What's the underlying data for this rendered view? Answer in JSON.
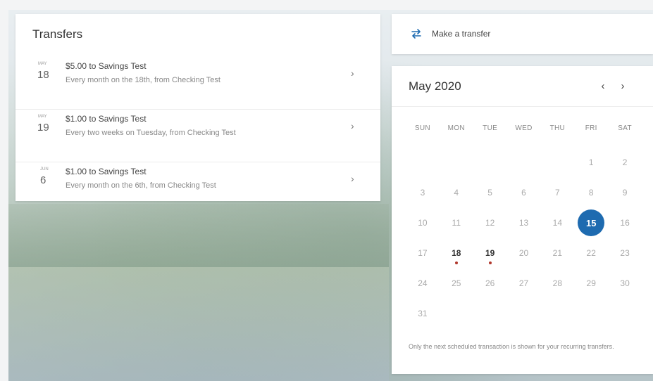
{
  "transfers": {
    "title": "Transfers",
    "items": [
      {
        "month": "MAY",
        "day": "18",
        "title": "$5.00 to Savings Test",
        "subtitle": "Every month on the 18th, from Checking Test"
      },
      {
        "month": "MAY",
        "day": "19",
        "title": "$1.00 to Savings Test",
        "subtitle": "Every two weeks on Tuesday, from Checking Test"
      },
      {
        "month": "JUN",
        "day": "6",
        "title": "$1.00 to Savings Test",
        "subtitle": "Every month on the 6th, from Checking Test"
      }
    ],
    "chevron": "›"
  },
  "make_transfer": {
    "label": "Make a transfer",
    "icon": "swap-arrows-icon",
    "icon_color": "#1e6bb0"
  },
  "calendar": {
    "title": "May 2020",
    "prev": "‹",
    "next": "›",
    "weekdays": [
      "SUN",
      "MON",
      "TUE",
      "WED",
      "THU",
      "FRI",
      "SAT"
    ],
    "first_weekday_index": 5,
    "days_in_month": 31,
    "today": 15,
    "event_days": [
      18,
      19
    ],
    "today_color": "#1e6bb0",
    "event_dot_color": "#b0372c",
    "note": "Only the next scheduled transaction is shown for your recurring transfers."
  }
}
